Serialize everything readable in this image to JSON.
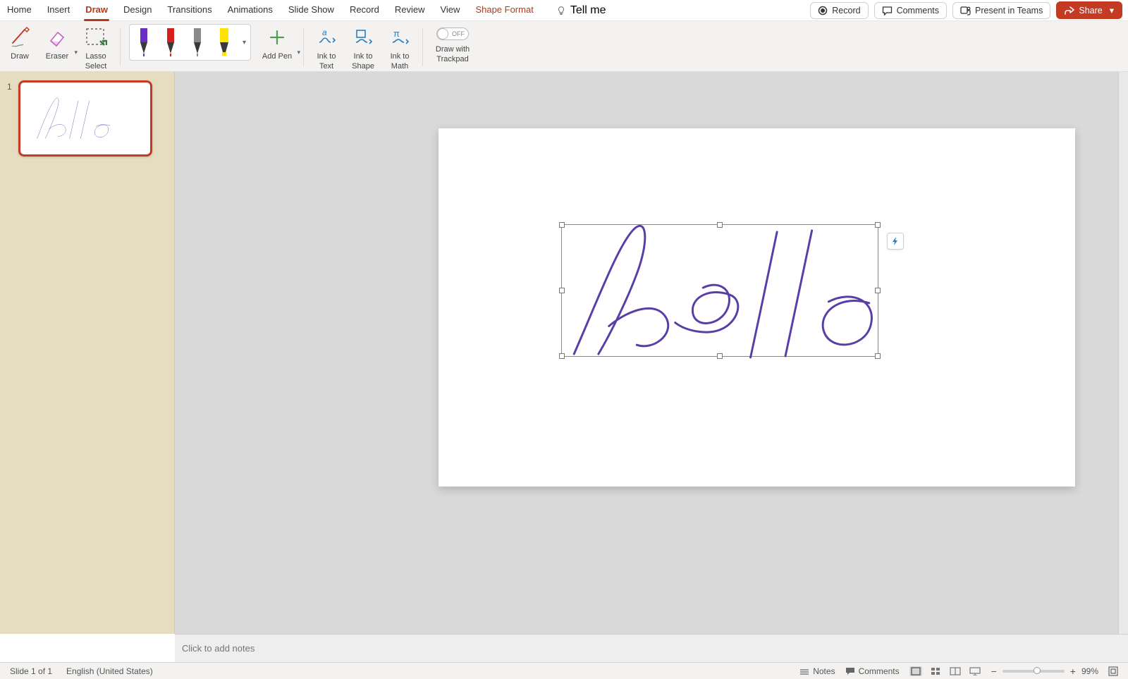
{
  "tabs": {
    "home": "Home",
    "insert": "Insert",
    "draw": "Draw",
    "design": "Design",
    "transitions": "Transitions",
    "animations": "Animations",
    "slide_show": "Slide Show",
    "record": "Record",
    "review": "Review",
    "view": "View",
    "shape_format": "Shape Format",
    "tell_me": "Tell me"
  },
  "top_right": {
    "record": "Record",
    "comments": "Comments",
    "present_in_teams": "Present in Teams",
    "share": "Share"
  },
  "ribbon": {
    "draw": "Draw",
    "eraser": "Eraser",
    "lasso_select_l1": "Lasso",
    "lasso_select_l2": "Select",
    "add_pen": "Add Pen",
    "ink_to_text_l1": "Ink to",
    "ink_to_text_l2": "Text",
    "ink_to_shape_l1": "Ink to",
    "ink_to_shape_l2": "Shape",
    "ink_to_math_l1": "Ink to",
    "ink_to_math_l2": "Math",
    "toggle_off": "OFF",
    "draw_with_trackpad_l1": "Draw with",
    "draw_with_trackpad_l2": "Trackpad"
  },
  "pens": [
    {
      "name": "pen-purple",
      "color": "#6a2ec7"
    },
    {
      "name": "pen-red",
      "color": "#d71f1f"
    },
    {
      "name": "pen-gray",
      "color": "#8a8a8a"
    },
    {
      "name": "highlighter-yellow",
      "color": "#ffe400"
    }
  ],
  "thumbnails": {
    "slide1_num": "1"
  },
  "notes": {
    "placeholder": "Click to add notes"
  },
  "status": {
    "slide_info": "Slide 1 of 1",
    "language": "English (United States)",
    "notes": "Notes",
    "comments": "Comments",
    "zoom": "99%"
  },
  "colors": {
    "accent": "#b33b1c",
    "ink": "#5a3ea8"
  }
}
